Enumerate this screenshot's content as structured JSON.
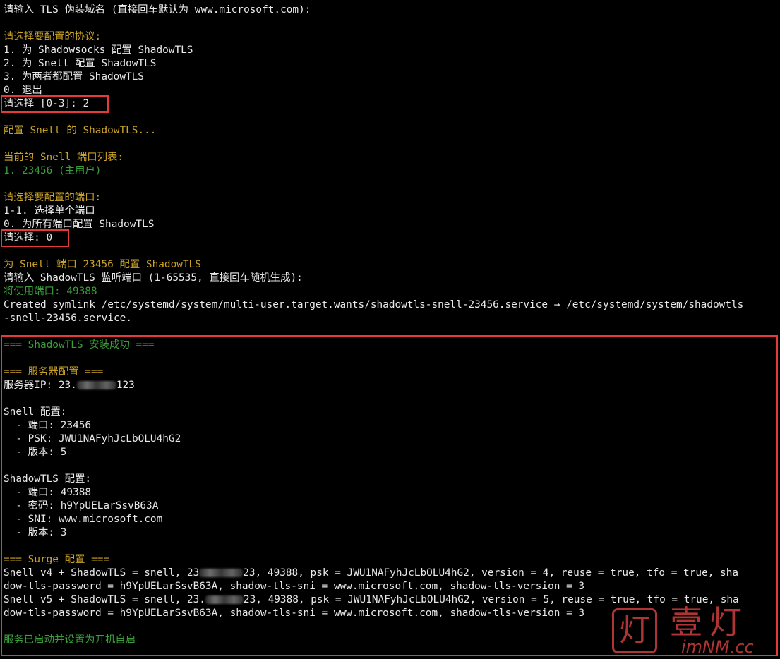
{
  "terminal": {
    "lines": [
      {
        "text": "请输入 TLS 伪装域名 (直接回车默认为 www.microsoft.com):",
        "color": "#e8e8e8"
      },
      {
        "text": "请选择要配置的协议:",
        "color": "#c9a227"
      },
      {
        "text": "1. 为 Shadowsocks 配置 ShadowTLS",
        "color": "#e8e8e8"
      },
      {
        "text": "2. 为 Snell 配置 ShadowTLS",
        "color": "#e8e8e8"
      },
      {
        "text": "3. 为两者都配置 ShadowTLS",
        "color": "#e8e8e8"
      },
      {
        "text": "0. 退出",
        "color": "#e8e8e8"
      },
      {
        "text": "请选择 [0-3]: 2",
        "color": "#e8e8e8"
      },
      {
        "text": "配置 Snell 的 ShadowTLS...",
        "color": "#c9a227"
      },
      {
        "text": "当前的 Snell 端口列表:",
        "color": "#c9a227"
      },
      {
        "text": "1. 23456 (主用户)",
        "color": "#3a9e3a"
      },
      {
        "text": "请选择要配置的端口:",
        "color": "#c9a227"
      },
      {
        "text": "1-1. 选择单个端口",
        "color": "#e8e8e8"
      },
      {
        "text": "0. 为所有端口配置 ShadowTLS",
        "color": "#e8e8e8"
      },
      {
        "text": "请选择: 0",
        "color": "#e8e8e8"
      },
      {
        "text": "为 Snell 端口 23456 配置 ShadowTLS",
        "color": "#c9a227"
      },
      {
        "text": "请输入 ShadowTLS 监听端口 (1-65535, 直接回车随机生成):",
        "color": "#e8e8e8"
      },
      {
        "text": "将使用端口: 49388",
        "color": "#3a9e3a"
      },
      {
        "text": "Created symlink /etc/systemd/system/multi-user.target.wants/shadowtls-snell-23456.service → /etc/systemd/system/shadowtls",
        "color": "#e8e8e8"
      },
      {
        "text": "-snell-23456.service.",
        "color": "#e8e8e8"
      },
      {
        "text": "=== ShadowTLS 安装成功 ===",
        "color": "#3a9e3a"
      },
      {
        "text": "=== 服务器配置 ===",
        "color": "#c9a227"
      },
      {
        "text_before": "服务器IP: 23.",
        "text_after": "123",
        "color": "#e8e8e8"
      },
      {
        "text": "Snell 配置:",
        "color": "#e8e8e8"
      },
      {
        "text": "  - 端口: 23456",
        "color": "#e8e8e8"
      },
      {
        "text": "  - PSK: JWU1NAFyhJcLbOLU4hG2",
        "color": "#e8e8e8"
      },
      {
        "text": "  - 版本: 5",
        "color": "#e8e8e8"
      },
      {
        "text": "ShadowTLS 配置:",
        "color": "#e8e8e8"
      },
      {
        "text": "  - 端口: 49388",
        "color": "#e8e8e8"
      },
      {
        "text": "  - 密码: h9YpUELarSsvB63A",
        "color": "#e8e8e8"
      },
      {
        "text": "  - SNI: www.microsoft.com",
        "color": "#e8e8e8"
      },
      {
        "text": "  - 版本: 3",
        "color": "#e8e8e8"
      },
      {
        "text": "=== Surge 配置 ===",
        "color": "#c9a227"
      },
      {
        "text_before": "Snell v4 + ShadowTLS = snell, 23",
        "text_after": "23, 49388, psk = JWU1NAFyhJcLbOLU4hG2, version = 4, reuse = true, tfo = true, sha",
        "color": "#e8e8e8"
      },
      {
        "text": "dow-tls-password = h9YpUELarSsvB63A, shadow-tls-sni = www.microsoft.com, shadow-tls-version = 3",
        "color": "#e8e8e8"
      },
      {
        "text_before": "Snell v5 + ShadowTLS = snell, 23.",
        "text_after": "23, 49388, psk = JWU1NAFyhJcLbOLU4hG2, version = 5, reuse = true, tfo = true, sha",
        "color": "#e8e8e8"
      },
      {
        "text": "dow-tls-password = h9YpUELarSsvB63A, shadow-tls-sni = www.microsoft.com, shadow-tls-version = 3",
        "color": "#e8e8e8"
      },
      {
        "text": "服务已启动并设置为开机自启",
        "color": "#3a9e3a"
      }
    ]
  },
  "watermark": {
    "stamp": "灯",
    "title": "壹灯",
    "subtitle": "imNM.cc"
  },
  "colors": {
    "background": "#000000",
    "text": "#e8e8e8",
    "yellow": "#c9a227",
    "green": "#3a9e3a",
    "highlight": "#e53a3a"
  }
}
